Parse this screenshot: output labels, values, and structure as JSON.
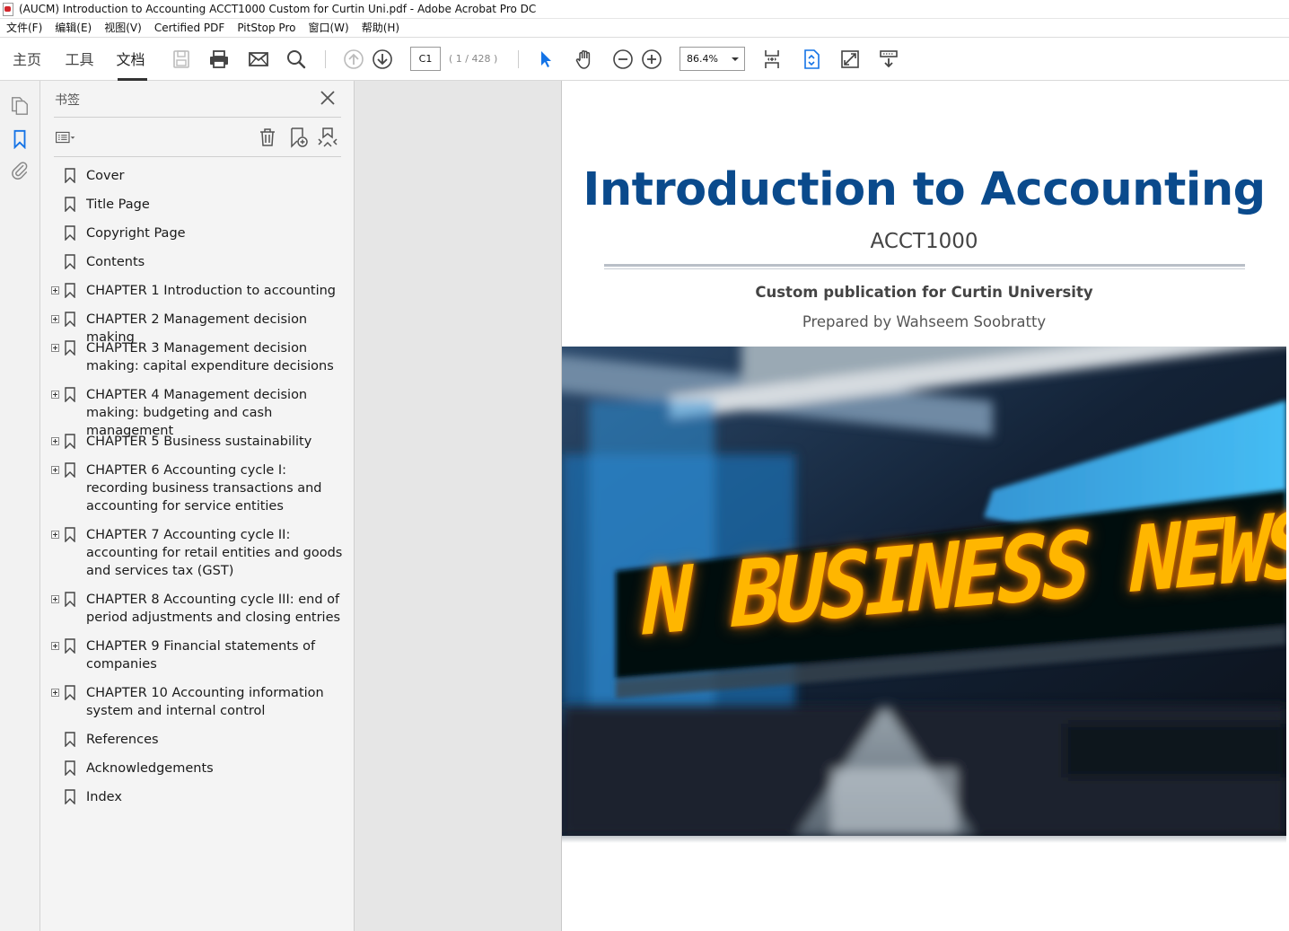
{
  "window": {
    "title": "(AUCM) Introduction to Accounting ACCT1000 Custom for Curtin Uni.pdf - Adobe Acrobat Pro DC"
  },
  "menu": [
    "文件(F)",
    "编辑(E)",
    "视图(V)",
    "Certified PDF",
    "PitStop Pro",
    "窗口(W)",
    "帮助(H)"
  ],
  "toolbar": {
    "tabs": [
      "主页",
      "工具",
      "文档"
    ],
    "active_tab": "文档",
    "page_current": "C1",
    "page_total": "( 1 / 428 )",
    "zoom": "86.4%"
  },
  "bookmarks": {
    "title": "书签",
    "items": [
      {
        "label": "Cover",
        "expandable": false
      },
      {
        "label": "Title Page",
        "expandable": false
      },
      {
        "label": "Copyright Page",
        "expandable": false
      },
      {
        "label": "Contents",
        "expandable": false
      },
      {
        "label": "CHAPTER 1 Introduction to accounting",
        "expandable": true
      },
      {
        "label": "CHAPTER 2 Management decision making",
        "expandable": true
      },
      {
        "label": "CHAPTER 3 Management decision making: capital expenditure decisions",
        "expandable": true
      },
      {
        "label": "CHAPTER 4 Management decision making: budgeting and cash management",
        "expandable": true
      },
      {
        "label": "CHAPTER 5 Business sustainability",
        "expandable": true
      },
      {
        "label": "CHAPTER 6 Accounting cycle I: recording business transactions and accounting for service entities",
        "expandable": true
      },
      {
        "label": "CHAPTER 7 Accounting cycle II: accounting for retail entities and goods and services tax (GST)",
        "expandable": true
      },
      {
        "label": "CHAPTER 8 Accounting cycle III: end of period adjustments and closing entries",
        "expandable": true
      },
      {
        "label": "CHAPTER 9 Financial statements of companies",
        "expandable": true
      },
      {
        "label": "CHAPTER 10 Accounting information system and internal control",
        "expandable": true
      },
      {
        "label": "References",
        "expandable": false
      },
      {
        "label": "Acknowledgements",
        "expandable": false
      },
      {
        "label": "Index",
        "expandable": false
      }
    ]
  },
  "document": {
    "title": "Introduction to Accounting",
    "code": "ACCT1000",
    "subtitle": "Custom publication for Curtin University",
    "prepared_by": "Prepared by Wahseem Soobratty",
    "cover_sign_text": "N BUSINESS NEWS"
  },
  "colors": {
    "title_blue": "#0a4a8c",
    "accent_blue": "#1473e6",
    "led_yellow": "#ffb600"
  }
}
